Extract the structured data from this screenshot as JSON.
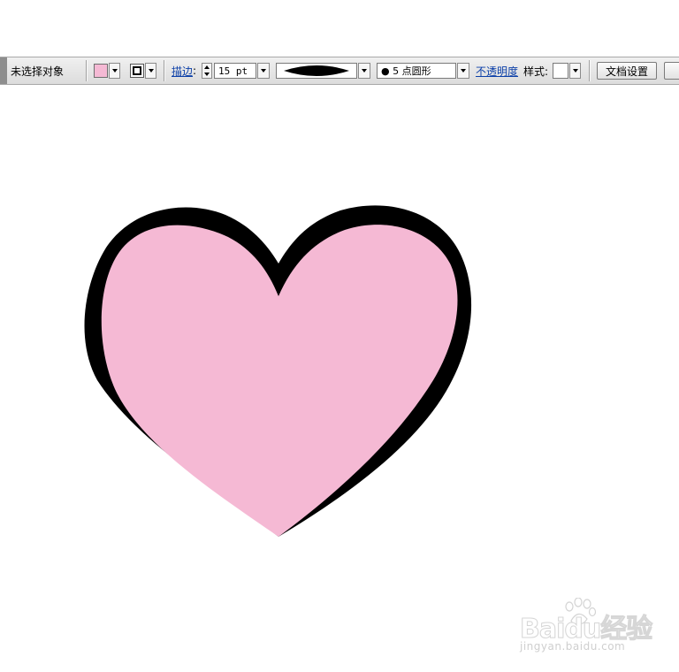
{
  "toolbar": {
    "selection_status": "未选择对象",
    "stroke_link": "描边",
    "stroke_colon": ":",
    "stroke_weight": "15 pt",
    "brush_label": "● 5 点圆形",
    "opacity_link": "不透明度",
    "style_label": "样式:",
    "doc_setup_button": "文档设置"
  },
  "colors": {
    "fill": "#f5b9d4",
    "stroke": "#000000",
    "link": "#0b3fa8"
  },
  "icons": {
    "fill_swatch": "fill-color-swatch",
    "stroke_swatch": "stroke-color-swatch",
    "profile_preview": "variable-width-profile"
  },
  "watermark": {
    "logo_text": "Baidu经验",
    "url": "jingyan.baidu.com"
  }
}
